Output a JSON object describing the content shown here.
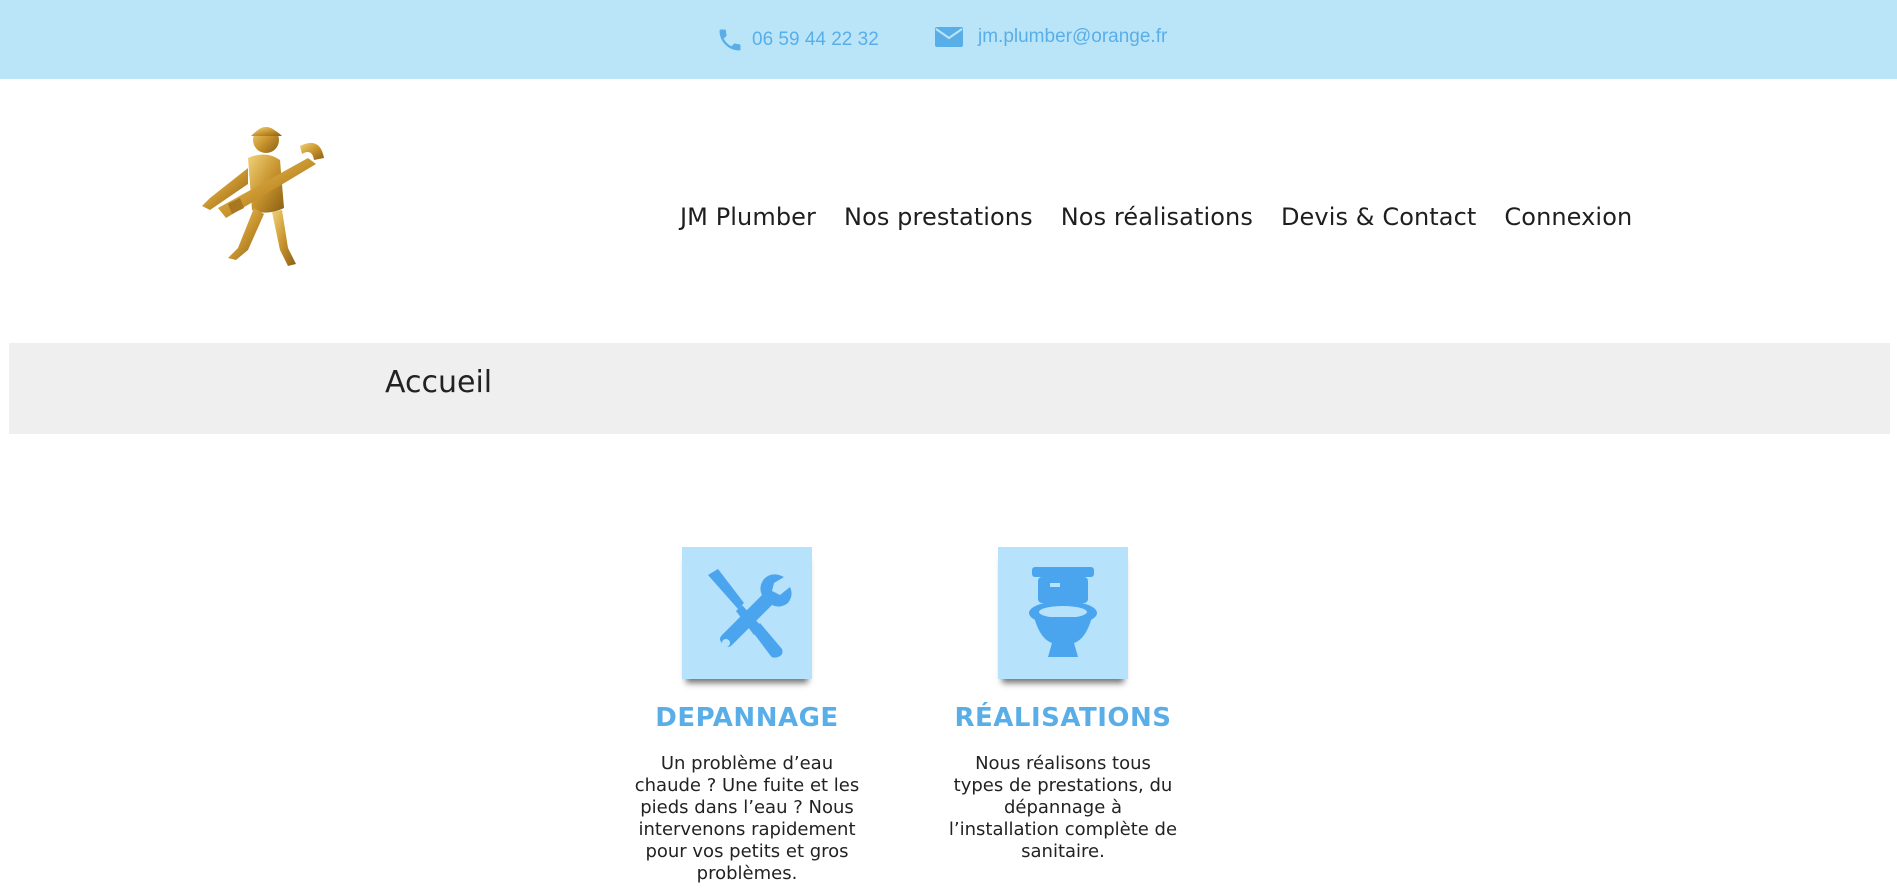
{
  "topbar": {
    "phone": "06 59 44 22 32",
    "email": "jm.plumber@orange.fr",
    "phone_icon": "phone-icon",
    "email_icon": "envelope-icon",
    "background_color": "#bae5f9",
    "text_color": "#5aaee8"
  },
  "header": {
    "logo_icon": "golden-plumber-wrench-logo",
    "nav": [
      {
        "label": "JM Plumber"
      },
      {
        "label": "Nos prestations"
      },
      {
        "label": "Nos réalisations"
      },
      {
        "label": "Devis & Contact"
      },
      {
        "label": "Connexion"
      }
    ]
  },
  "band": {
    "title": "Accueil"
  },
  "services": [
    {
      "icon": "tools-icon",
      "title": "DEPANNAGE",
      "text": "Un problème d’eau chaude ? Une fuite et les pieds dans l’eau ? Nous intervenons rapidement pour vos petits et gros problèmes."
    },
    {
      "icon": "toilet-icon",
      "title": "RÉALISATIONS",
      "text": "Nous réalisons tous types de prestations, du dépannage à l’installation complète de sanitaire."
    }
  ]
}
